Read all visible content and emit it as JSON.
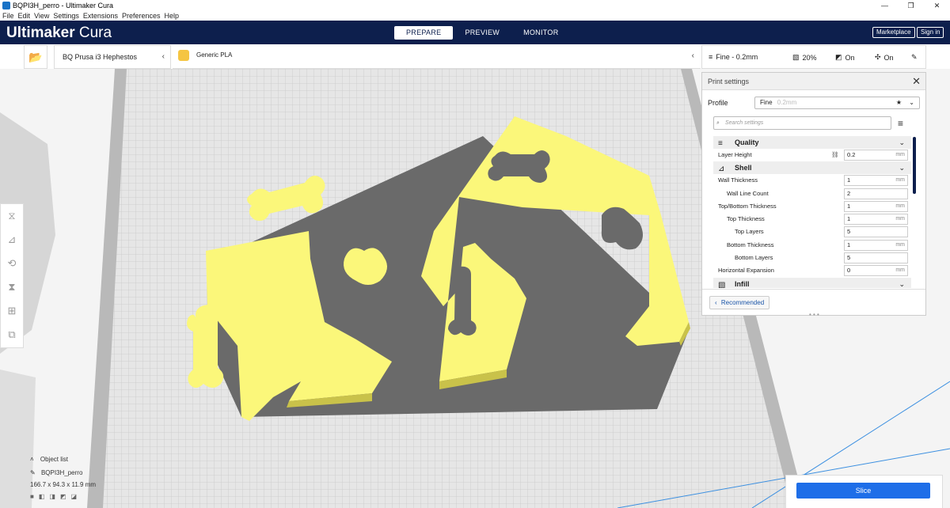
{
  "window": {
    "title": "BQPI3H_perro - Ultimaker Cura",
    "controls": [
      "—",
      "❐",
      "✕"
    ]
  },
  "menu": [
    "File",
    "Edit",
    "View",
    "Settings",
    "Extensions",
    "Preferences",
    "Help"
  ],
  "header": {
    "brand_main": "Ultimaker",
    "brand_sub": "Cura",
    "tabs": [
      "PREPARE",
      "PREVIEW",
      "MONITOR"
    ],
    "active_tab": "PREPARE",
    "marketplace": "Marketplace",
    "signin": "Sign in"
  },
  "toolbar": {
    "printer": "BQ Prusa i3 Hephestos",
    "material": "Generic PLA",
    "profile": "Fine - 0.2mm",
    "infill": "20%",
    "support": "On",
    "adhesion": "On"
  },
  "panel": {
    "title": "Print settings",
    "profile_label": "Profile",
    "profile_value": "Fine",
    "profile_hint": "0.2mm",
    "search_placeholder": "Search settings",
    "recommended": "Recommended",
    "categories": {
      "quality": "Quality",
      "shell": "Shell",
      "infill": "Infill"
    },
    "settings": [
      {
        "label": "Layer Height",
        "value": "0.2",
        "unit": "mm"
      },
      {
        "label": "Wall Thickness",
        "value": "1",
        "unit": "mm"
      },
      {
        "label": "Wall Line Count",
        "value": "2",
        "unit": ""
      },
      {
        "label": "Top/Bottom Thickness",
        "value": "1",
        "unit": "mm"
      },
      {
        "label": "Top Thickness",
        "value": "1",
        "unit": "mm"
      },
      {
        "label": "Top Layers",
        "value": "5",
        "unit": ""
      },
      {
        "label": "Bottom Thickness",
        "value": "1",
        "unit": "mm"
      },
      {
        "label": "Bottom Layers",
        "value": "5",
        "unit": ""
      },
      {
        "label": "Horizontal Expansion",
        "value": "0",
        "unit": "mm"
      }
    ]
  },
  "objects": {
    "header": "Object list",
    "name": "BQPI3H_perro",
    "dimensions": "166.7 x 94.3 x 11.9 mm"
  },
  "slice": "Slice",
  "colors": {
    "header_bg": "#0d1f4d",
    "model": "#fbf77a",
    "accent": "#1e6ee8"
  }
}
